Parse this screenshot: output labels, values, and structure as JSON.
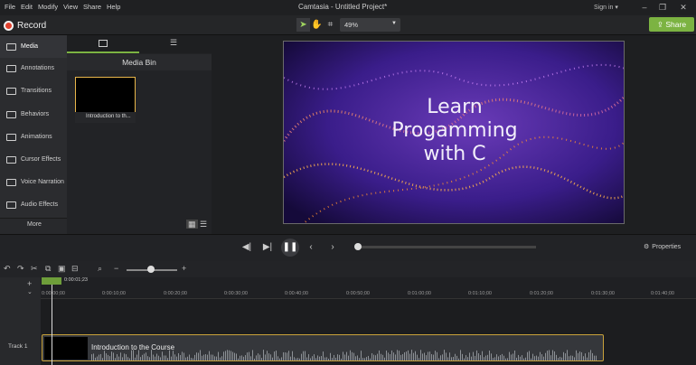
{
  "menu": [
    "File",
    "Edit",
    "Modify",
    "View",
    "Share",
    "Help"
  ],
  "app_title": "Camtasia - Untitled Project*",
  "sign_in": "Sign in ▾",
  "record_label": "Record",
  "zoom_level": "49%",
  "share_label": "Share",
  "sidebar": {
    "items": [
      {
        "label": "Media"
      },
      {
        "label": "Annotations"
      },
      {
        "label": "Transitions"
      },
      {
        "label": "Behaviors"
      },
      {
        "label": "Animations"
      },
      {
        "label": "Cursor Effects"
      },
      {
        "label": "Voice Narration"
      },
      {
        "label": "Audio Effects"
      }
    ],
    "more_label": "More"
  },
  "media_bin": {
    "title": "Media Bin",
    "clip_label": "Introduction to th..."
  },
  "preview": {
    "text": "Learn\nProgamming\nwith C"
  },
  "playback": {
    "properties_label": "Properties"
  },
  "timeline": {
    "playhead_time": "0:00:01;23",
    "ticks": [
      "0:00:00;00",
      "0:00:10;00",
      "0:00:20;00",
      "0:00:30;00",
      "0:00:40;00",
      "0:00:50;00",
      "0:01:00;00",
      "0:01:10;00",
      "0:01:20;00",
      "0:01:30;00",
      "0:01:40;00"
    ],
    "track_label": "Track 1",
    "clip_name": "Introduction to the Course"
  },
  "colors": {
    "accent": "#7cb342",
    "record": "#e0412e",
    "clip_border": "#c9a23a"
  }
}
